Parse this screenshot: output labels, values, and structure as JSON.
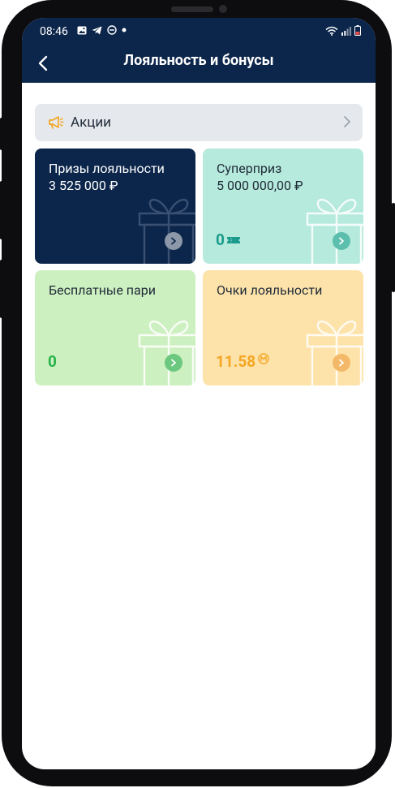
{
  "status_bar": {
    "time": "08:46"
  },
  "header": {
    "title": "Лояльность и бонусы"
  },
  "promo": {
    "label": "Акции"
  },
  "cards": [
    {
      "name": "Призы лояльности",
      "amount": "3 525 000 ₽",
      "bg": "#0c264b"
    },
    {
      "name": "Суперприз",
      "amount": "5 000 000,00 ₽",
      "value": "0",
      "bg": "#b6eadc"
    },
    {
      "name": "Бесплатные пари",
      "value": "0",
      "bg": "#cdf0c0"
    },
    {
      "name": "Очки лояльности",
      "value": "11.58",
      "bg": "#fde3aa"
    }
  ],
  "colors": {
    "accent_orange": "#f5a623",
    "accent_green": "#27b34a",
    "accent_teal": "#1b9c8c"
  }
}
